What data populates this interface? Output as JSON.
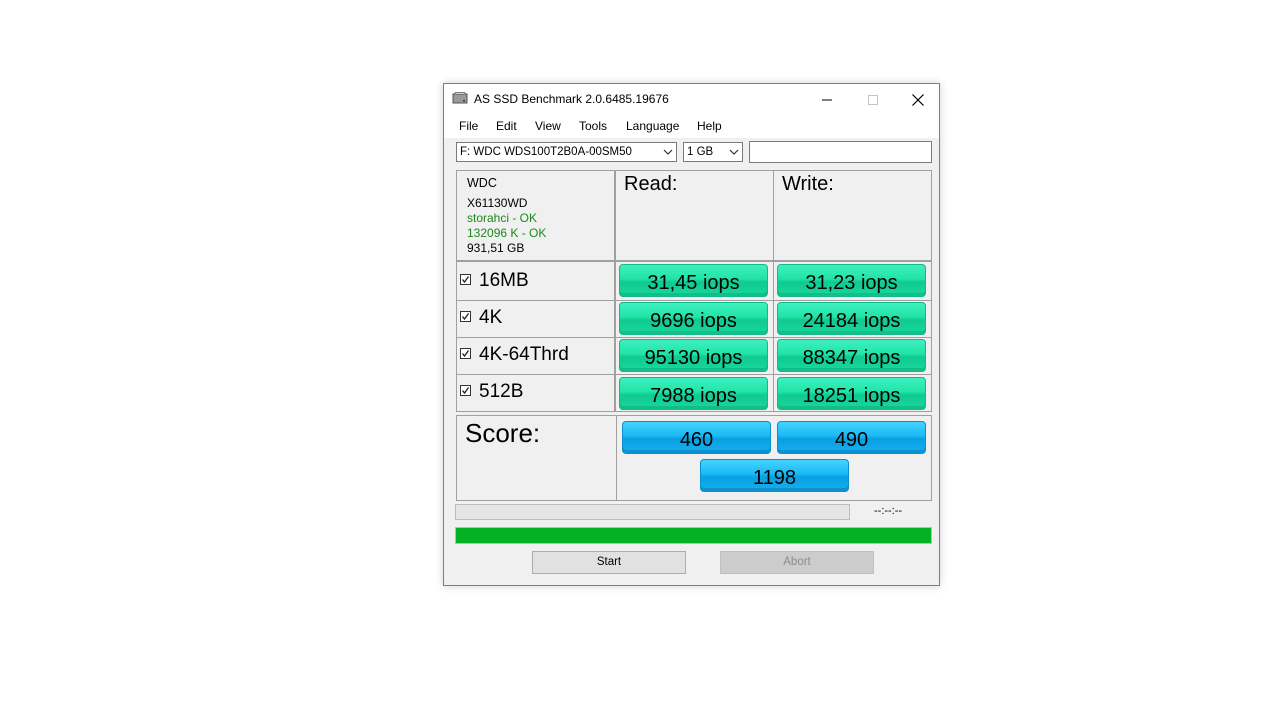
{
  "window": {
    "title": "AS SSD Benchmark 2.0.6485.19676",
    "minimize_icon": "minimize-icon",
    "maximize_icon": "maximize-icon",
    "close_icon": "close-icon"
  },
  "menu": [
    "File",
    "Edit",
    "View",
    "Tools",
    "Language",
    "Help"
  ],
  "toolbar": {
    "drive_select": "F: WDC WDS100T2B0A-00SM50",
    "size_select": "1 GB",
    "text_field_value": ""
  },
  "drive_info": {
    "vendor": "WDC",
    "firmware": "X61130WD",
    "driver_status": "storahci - OK",
    "alignment_status": "132096 K - OK",
    "capacity": "931,51 GB",
    "ok_color": "#1a8a1a"
  },
  "headers": {
    "read": "Read:",
    "write": "Write:"
  },
  "tests": [
    {
      "label": "16MB",
      "checked": true,
      "read": "31,45 iops",
      "write": "31,23 iops"
    },
    {
      "label": "4K",
      "checked": true,
      "read": "9696 iops",
      "write": "24184 iops"
    },
    {
      "label": "4K-64Thrd",
      "checked": true,
      "read": "95130 iops",
      "write": "88347 iops"
    },
    {
      "label": "512B",
      "checked": true,
      "read": "7988 iops",
      "write": "18251 iops"
    }
  ],
  "score": {
    "label": "Score:",
    "read": "460",
    "write": "490",
    "total": "1198"
  },
  "progress": {
    "time": "--:--:--",
    "overall_fraction": 1.0
  },
  "buttons": {
    "start": "Start",
    "abort": "Abort"
  },
  "colors": {
    "result_green": "#20e4a7",
    "score_blue": "#19b8f5",
    "progress_green": "#06b025",
    "window_border": "#3b8fd9"
  }
}
